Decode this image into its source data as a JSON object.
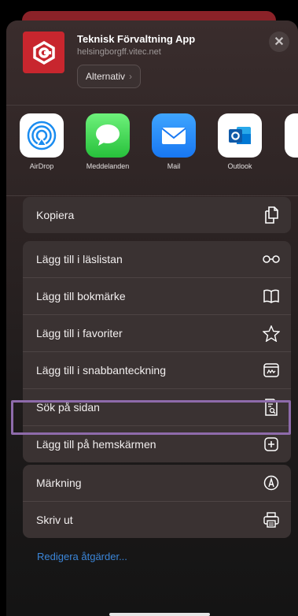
{
  "app": {
    "title": "Teknisk Förvaltning App",
    "url": "helsingborgff.vitec.net",
    "options_label": "Alternativ",
    "close_label": "✕",
    "icon_color": "#c8262e"
  },
  "share_apps": [
    {
      "name": "AirDrop",
      "icon": "airdrop-icon"
    },
    {
      "name": "Meddelanden",
      "icon": "messages-icon"
    },
    {
      "name": "Mail",
      "icon": "mail-icon"
    },
    {
      "name": "Outlook",
      "icon": "outlook-icon"
    }
  ],
  "groups": [
    {
      "items": [
        {
          "label": "Kopiera",
          "icon": "copy-icon"
        }
      ]
    },
    {
      "items": [
        {
          "label": "Lägg till i läslistan",
          "icon": "glasses-icon"
        },
        {
          "label": "Lägg till bokmärke",
          "icon": "book-icon"
        },
        {
          "label": "Lägg till i favoriter",
          "icon": "star-icon"
        },
        {
          "label": "Lägg till i snabbanteckning",
          "icon": "quick-note-icon"
        },
        {
          "label": "Sök på sidan",
          "icon": "find-on-page-icon"
        },
        {
          "label": "Lägg till på hemskärmen",
          "icon": "add-square-icon"
        }
      ]
    },
    {
      "items": [
        {
          "label": "Märkning",
          "icon": "markup-icon"
        },
        {
          "label": "Skriv ut",
          "icon": "printer-icon"
        }
      ]
    }
  ],
  "edit_actions_label": "Redigera åtgärder...",
  "colors": {
    "accent": "#3b86d9",
    "highlight": "#8e6bab"
  }
}
